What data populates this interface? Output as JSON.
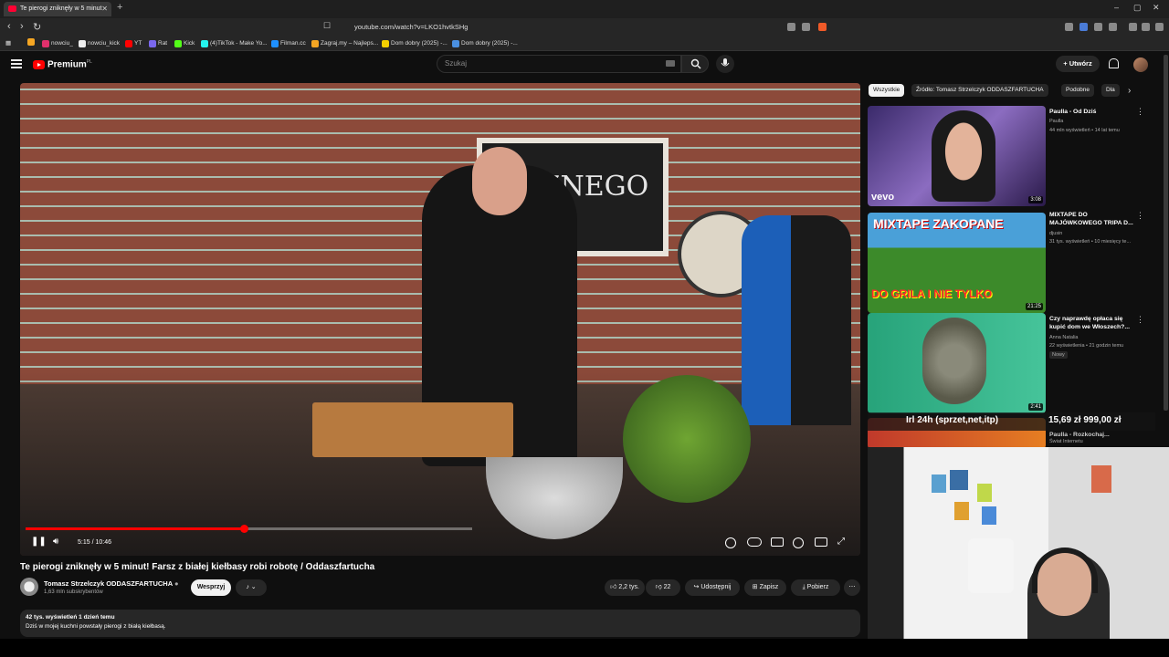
{
  "browser": {
    "tab_title": "Te pierogi zniknęły w 5 minut",
    "new_tab": "+",
    "url": "youtube.com/watch?v=LKO1hvtkSHg",
    "window_controls": [
      "–",
      "▢",
      "✕"
    ],
    "bookmarks": [
      {
        "label": "nowciu_",
        "color": "#e1306c"
      },
      {
        "label": "nowciu_kick",
        "color": "#ffffff"
      },
      {
        "label": "YT",
        "color": "#ff0000"
      },
      {
        "label": "Rat",
        "color": "#7b68ee"
      },
      {
        "label": "Kick",
        "color": "#53fc18"
      },
      {
        "label": "(4)TikTok - Make Yo...",
        "color": "#25f4ee"
      },
      {
        "label": "Filman.cc",
        "color": "#1e90ff"
      },
      {
        "label": "Zagraj.my – Najleps...",
        "color": "#f5a623"
      },
      {
        "label": "Dom dobry (2025) -...",
        "color": "#f5d000"
      },
      {
        "label": "Dom dobry (2025) -...",
        "color": "#4a90e2"
      }
    ]
  },
  "youtube": {
    "brand": "Premium",
    "brand_country": "PL",
    "search_placeholder": "Szukaj",
    "create_label": "+ Utwórz"
  },
  "video": {
    "chalkboard_text": "ACZNEGO",
    "current_time": "5:15",
    "duration": "10:46",
    "time_display": "5:15 / 10:46",
    "progress_fraction": 0.488,
    "title": "Te pierogi zniknęły w 5 minut! Farsz z białej kiełbasy robi robotę / Oddaszfartucha",
    "channel": "Tomasz Strzelczyk ODDASZFARTUCHA",
    "subscribers": "1,63 mln subskrybentów",
    "support_label": "Wesprzyj",
    "likes": "2,2 tys.",
    "dislikes": "22",
    "share_label": "Udostępnij",
    "save_label": "Zapisz",
    "download_label": "Pobierz",
    "views_line": "42 tys. wyświetleń  1 dzień temu",
    "description": "Dziś w mojej kuchni powstały pierogi z białą kiełbasą."
  },
  "sidebar": {
    "chips": [
      "Wszystkie",
      "Źródło: Tomasz Strzelczyk ODDASZFARTUCHA",
      "Podobne",
      "Dla"
    ],
    "items": [
      {
        "title": "Paulla - Od Dziś",
        "channel": "Paulla",
        "meta": "44 mln wyświetleń • 14 lat temu",
        "duration": "3:08",
        "badge": "vevo"
      },
      {
        "title": "MIXTAPE DO MAJÓWKOWEGO TRIPA D...",
        "channel": "djusin",
        "meta": "31 tys. wyświetleń • 10 miesięcy te...",
        "duration": "21:25",
        "thumb_text_top": "MIXTAPE ZAKOPANE",
        "thumb_text_bottom": "DO GRILA I NIE TYLKO"
      },
      {
        "title": "Czy naprawdę opłaca się kupić dom we Włoszech?...",
        "channel": "Anna Natalia",
        "meta": "22 wyświetlenia • 21 godzin temu",
        "badge_new": "Nowy",
        "duration": "2:41"
      },
      {
        "title": "Paulla - Rozkochaj...",
        "channel": "Świat Internetu"
      }
    ]
  },
  "overlay": {
    "left": "Irl 24h (sprzet,net,itp)",
    "right": "15,69 zł  999,00 zł"
  },
  "colors": {
    "youtube_red": "#ff0000",
    "background": "#0f0f0f",
    "chip_bg": "#272727"
  }
}
